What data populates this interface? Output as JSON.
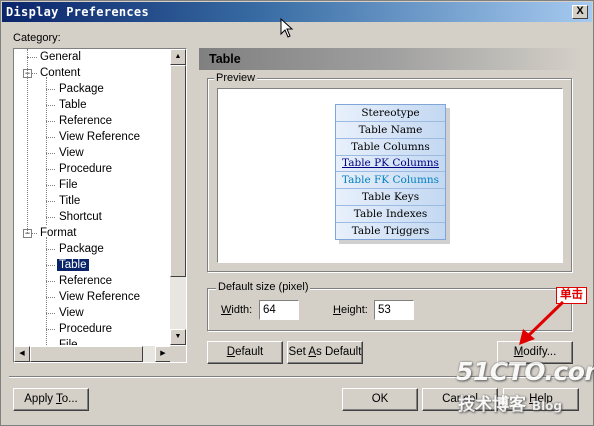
{
  "window": {
    "title": "Display Preferences",
    "close_glyph": "X"
  },
  "category": {
    "label": "Category:",
    "tree": [
      {
        "label": "General",
        "level": 1,
        "selected": false
      },
      {
        "label": "Content",
        "level": 0,
        "expander": "−",
        "selected": false
      },
      {
        "label": "Package",
        "level": 2,
        "selected": false
      },
      {
        "label": "Table",
        "level": 2,
        "selected": false
      },
      {
        "label": "Reference",
        "level": 2,
        "selected": false
      },
      {
        "label": "View Reference",
        "level": 2,
        "selected": false
      },
      {
        "label": "View",
        "level": 2,
        "selected": false
      },
      {
        "label": "Procedure",
        "level": 2,
        "selected": false
      },
      {
        "label": "File",
        "level": 2,
        "selected": false
      },
      {
        "label": "Title",
        "level": 2,
        "selected": false
      },
      {
        "label": "Shortcut",
        "level": 2,
        "selected": false
      },
      {
        "label": "Format",
        "level": 0,
        "expander": "−",
        "selected": false
      },
      {
        "label": "Package",
        "level": 2,
        "selected": false
      },
      {
        "label": "Table",
        "level": 2,
        "selected": true
      },
      {
        "label": "Reference",
        "level": 2,
        "selected": false
      },
      {
        "label": "View Reference",
        "level": 2,
        "selected": false
      },
      {
        "label": "View",
        "level": 2,
        "selected": false
      },
      {
        "label": "Procedure",
        "level": 2,
        "selected": false
      },
      {
        "label": "File",
        "level": 2,
        "selected": false
      }
    ]
  },
  "section": {
    "title": "Table"
  },
  "preview": {
    "label": "Preview",
    "table_rows": [
      {
        "label": "Stereotype",
        "style": "normal"
      },
      {
        "label": "Table Name",
        "style": "normal"
      },
      {
        "label": "Table Columns",
        "style": "normal"
      },
      {
        "label": "Table PK Columns",
        "style": "pk"
      },
      {
        "label": "Table FK Columns",
        "style": "fk"
      },
      {
        "label": "Table Keys",
        "style": "normal"
      },
      {
        "label": "Table Indexes",
        "style": "normal"
      },
      {
        "label": "Table Triggers",
        "style": "normal"
      }
    ]
  },
  "default_size": {
    "label": "Default size (pixel)",
    "width_label": "Width:",
    "width_value": "64",
    "height_label": "Height:",
    "height_value": "53"
  },
  "buttons": {
    "default": "Default",
    "set_as_default": "Set As Default",
    "modify": "Modify...",
    "apply_to": "Apply To...",
    "ok": "OK",
    "cancel": "Cancel",
    "help": "Help"
  },
  "annotation": {
    "callout": "单击"
  },
  "watermark": {
    "line1": "51CTO.com",
    "line2": "技术博客",
    "line3": "Blog"
  },
  "colors": {
    "annotation": "#e00000",
    "title_bar": "#0a246a",
    "selection": "#0a246a"
  }
}
